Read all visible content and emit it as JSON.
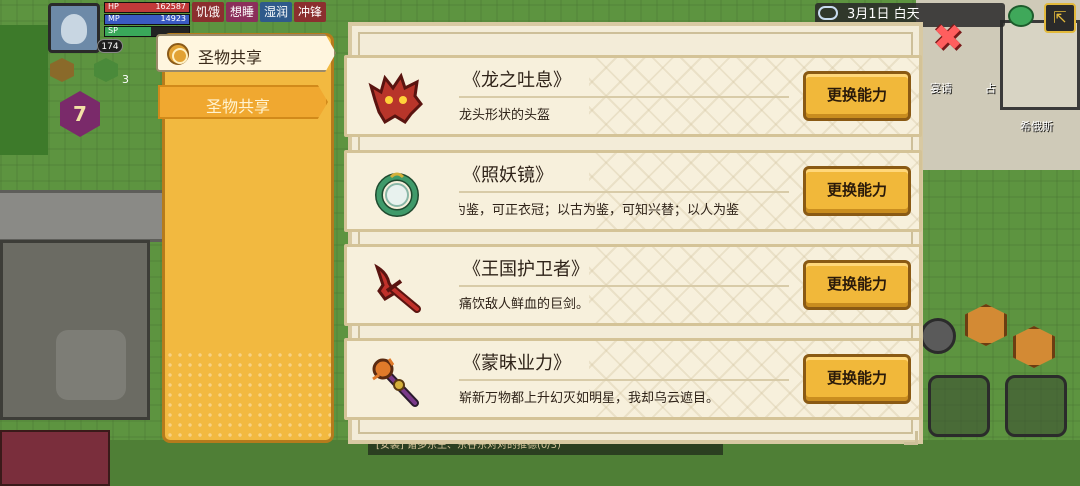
{
  "hud": {
    "hp_label": "HP",
    "hp_value": "162587",
    "mp_label": "MP",
    "mp_value": "14923",
    "sp_label": "SP",
    "player_level": "174",
    "status_tags": [
      {
        "label": "饥饿",
        "color": "#8b2f2f"
      },
      {
        "label": "想睡",
        "color": "#8b2f5a"
      },
      {
        "label": "湿润",
        "color": "#2f5a8b"
      },
      {
        "label": "冲锋",
        "color": "#8b2f2f"
      }
    ],
    "gem_level": "7",
    "item_count": "3",
    "date_time": "3月1日  白天",
    "invite_label": "宴请",
    "place_label": "占",
    "location_label": "希俄斯",
    "chat_text": "[安装] 诸多东主、东谷东对对的推德(0/3)"
  },
  "sidebar": {
    "active_tab_label": "圣物共享",
    "tab_label": "圣物共享"
  },
  "relics": [
    {
      "name": "《龙之吐息》",
      "description": "龙头形状的头盔",
      "button": "更换能力",
      "icon": "dragon-helmet-icon",
      "color": "#b8352a"
    },
    {
      "name": "《照妖镜》",
      "description": "以铜为鉴，可正衣冠；以古为鉴，可知兴替；以人为鉴",
      "button": "更换能力",
      "icon": "mirror-icon",
      "color": "#3f9a6a"
    },
    {
      "name": "《王国护卫者》",
      "description": "痛饮敌人鲜血的巨剑。",
      "button": "更换能力",
      "icon": "greatsword-icon",
      "color": "#c0302a"
    },
    {
      "name": "《蒙昧业力》",
      "description": "崭新万物都上升幻灭如明星，我却乌云遮目。",
      "button": "更换能力",
      "icon": "karma-staff-icon",
      "color": "#7a3a8a"
    }
  ]
}
